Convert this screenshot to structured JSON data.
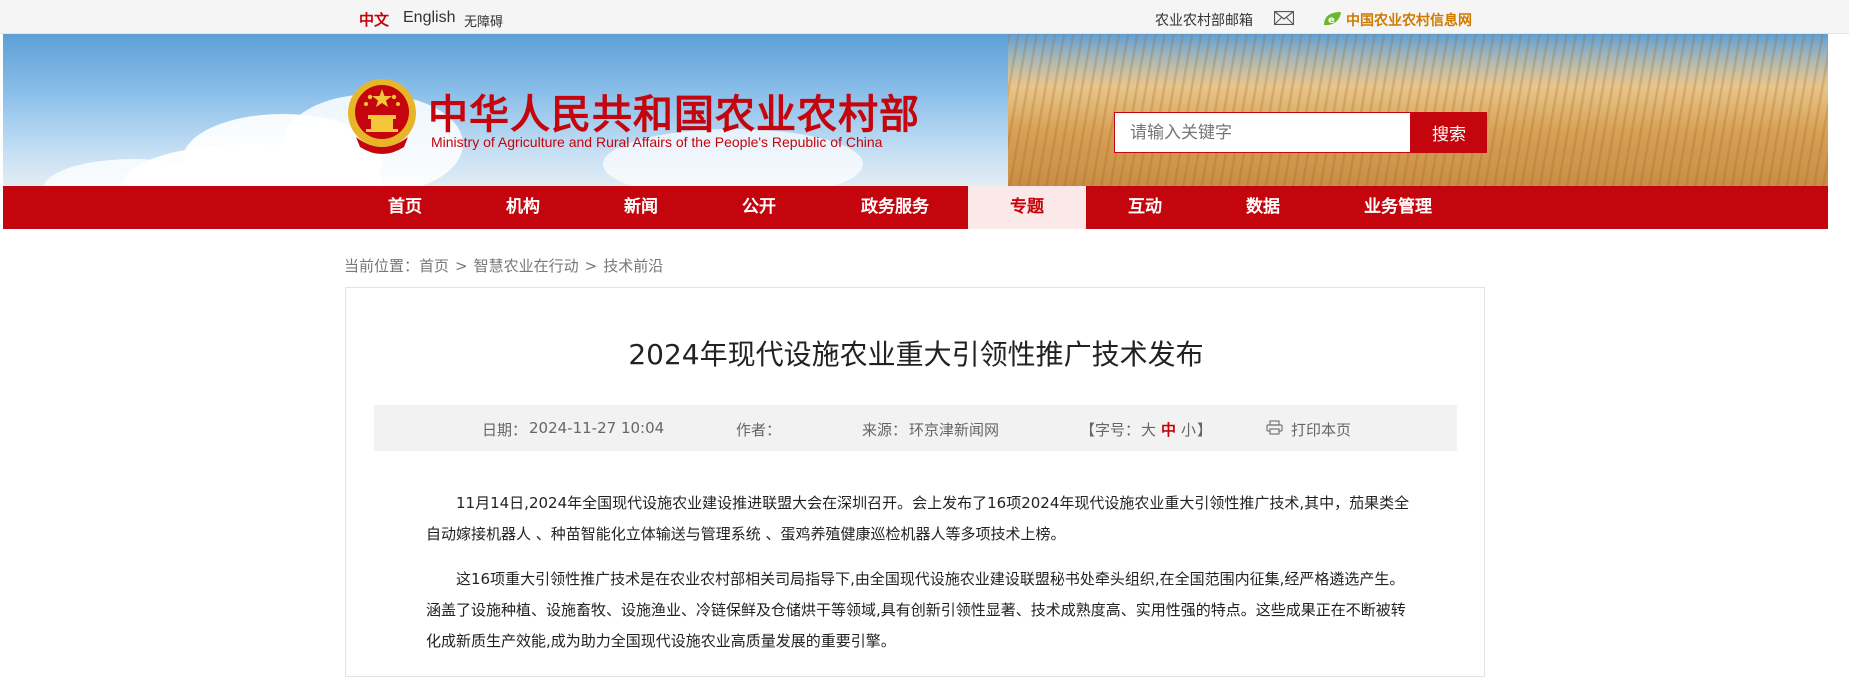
{
  "topbar": {
    "lang_cn": "中文",
    "lang_en": "English",
    "accessibility": "无障碍",
    "mailbox": "农业农村部邮箱",
    "info_network": "中国农业农村信息网",
    "mail_icon": "envelope-icon",
    "info_icon": "leaf-e-logo-icon"
  },
  "header": {
    "site_title": "中华人民共和国农业农村部",
    "site_subtitle": "Ministry of Agriculture and Rural Affairs of the People's Republic of China",
    "search_placeholder": "请输入关键字",
    "search_button": "搜索",
    "brand_color": "#c4050d"
  },
  "nav": {
    "items": [
      {
        "label": "首页"
      },
      {
        "label": "机构"
      },
      {
        "label": "新闻"
      },
      {
        "label": "公开"
      },
      {
        "label": "政务服务"
      },
      {
        "label": "专题",
        "active": true
      },
      {
        "label": "互动"
      },
      {
        "label": "数据"
      },
      {
        "label": "业务管理"
      }
    ]
  },
  "breadcrumb": {
    "prefix": "当前位置：",
    "items": [
      "首页",
      "智慧农业在行动",
      "技术前沿"
    ],
    "separator": ">"
  },
  "article": {
    "title": "2024年现代设施农业重大引领性推广技术发布",
    "meta": {
      "date_label": "日期：",
      "date": "2024-11-27 10:04",
      "author_label": "作者：",
      "source_label": "来源：",
      "source": "环京津新闻网",
      "font_size_open": "【字号：",
      "font_big": "大",
      "font_mid": "中",
      "font_small": "小",
      "font_size_close": "】",
      "print": "打印本页"
    },
    "paragraphs": [
      "11月14日,2024年全国现代设施农业建设推进联盟大会在深圳召开。会上发布了16项2024年现代设施农业重大引领性推广技术,其中，茄果类全自动嫁接机器人 、种苗智能化立体输送与管理系统 、蛋鸡养殖健康巡检机器人等多项技术上榜。",
      "这16项重大引领性推广技术是在农业农村部相关司局指导下,由全国现代设施农业建设联盟秘书处牵头组织,在全国范围内征集,经严格遴选产生。涵盖了设施种植、设施畜牧、设施渔业、冷链保鲜及仓储烘干等领域,具有创新引领性显著、技术成熟度高、实用性强的特点。这些成果正在不断被转化成新质生产效能,成为助力全国现代设施农业高质量发展的重要引擎。"
    ]
  }
}
